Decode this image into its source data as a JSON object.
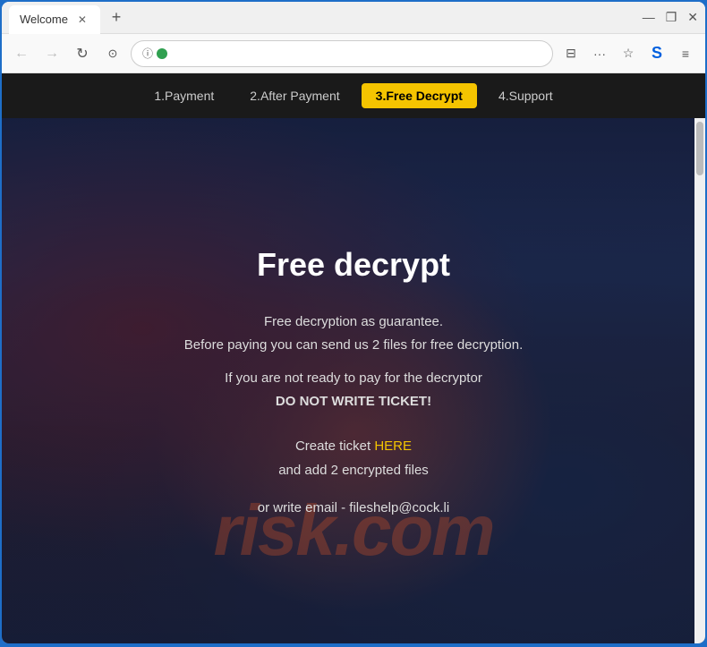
{
  "browser": {
    "tab_title": "Welcome",
    "new_tab_icon": "+",
    "window_controls": {
      "minimize": "—",
      "maximize": "❐",
      "close": "✕"
    }
  },
  "address_bar": {
    "back_icon": "←",
    "forward_icon": "→",
    "reload_icon": "↻",
    "home_icon": "⊙",
    "security_dot": "green",
    "menu_icon": "≡",
    "bookmark_icon": "☆",
    "account_icon": "S",
    "more_icon": "···"
  },
  "nav": {
    "items": [
      {
        "label": "1.Payment",
        "active": false
      },
      {
        "label": "2.After Payment",
        "active": false
      },
      {
        "label": "3.Free Decrypt",
        "active": true
      },
      {
        "label": "4.Support",
        "active": false
      }
    ]
  },
  "page": {
    "title": "Free decrypt",
    "line1": "Free decryption as guarantee.",
    "line2": "Before paying you can send us 2 files for free decryption.",
    "line3": "If you are not ready to pay for the decryptor",
    "line4": "DO NOT WRITE TICKET!",
    "ticket_prefix": "Create ticket ",
    "ticket_link": "HERE",
    "ticket_suffix": "and add 2 encrypted files",
    "email_line": "or write email - fileshelp@cock.li",
    "watermark": "risk.com"
  }
}
